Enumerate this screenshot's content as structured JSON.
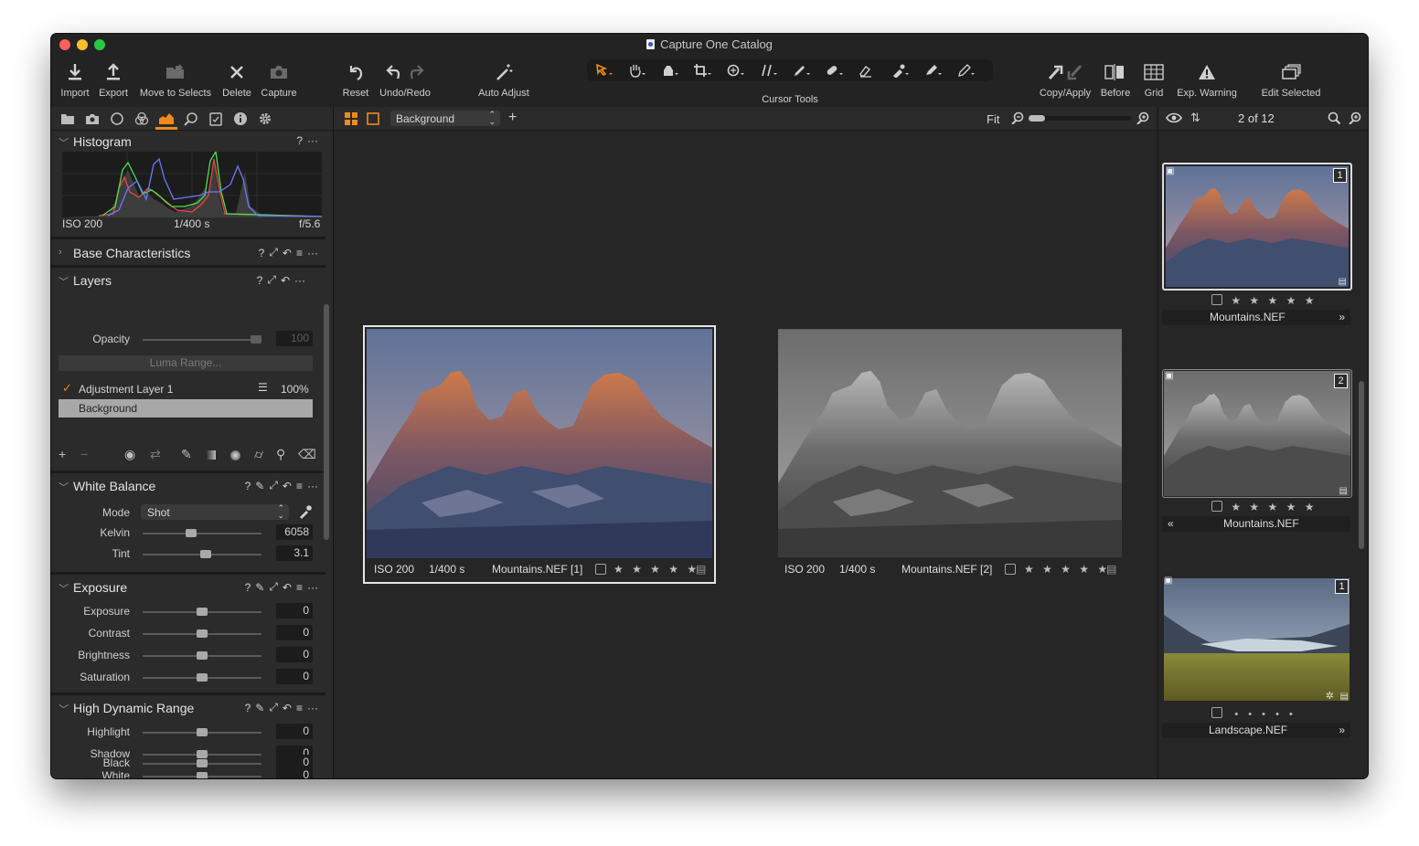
{
  "window": {
    "title": "Capture One Catalog"
  },
  "toolbar": {
    "import": "Import",
    "export": "Export",
    "move_to_selects": "Move to Selects",
    "delete": "Delete",
    "capture": "Capture",
    "reset": "Reset",
    "undo_redo": "Undo/Redo",
    "auto_adjust": "Auto Adjust",
    "cursor_tools": "Cursor Tools",
    "copy_apply": "Copy/Apply",
    "before": "Before",
    "grid": "Grid",
    "exp_warning": "Exp. Warning",
    "edit_selected": "Edit Selected"
  },
  "histogram": {
    "title": "Histogram",
    "iso": "ISO 200",
    "shutter": "1/400 s",
    "aperture": "f/5.6",
    "help": "?"
  },
  "base_characteristics": {
    "title": "Base Characteristics",
    "help": "?"
  },
  "layers": {
    "title": "Layers",
    "help": "?",
    "opacity_label": "Opacity",
    "opacity_value": "100",
    "luma_range": "Luma Range...",
    "items": [
      {
        "name": "Adjustment Layer 1",
        "opacity": "100%",
        "checked": true
      },
      {
        "name": "Background"
      }
    ]
  },
  "white_balance": {
    "title": "White Balance",
    "help": "?",
    "mode_label": "Mode",
    "mode_value": "Shot",
    "kelvin_label": "Kelvin",
    "kelvin_value": "6058",
    "tint_label": "Tint",
    "tint_value": "3.1"
  },
  "exposure": {
    "title": "Exposure",
    "help": "?",
    "rows": [
      {
        "label": "Exposure",
        "value": "0"
      },
      {
        "label": "Contrast",
        "value": "0"
      },
      {
        "label": "Brightness",
        "value": "0"
      },
      {
        "label": "Saturation",
        "value": "0"
      }
    ]
  },
  "hdr": {
    "title": "High Dynamic Range",
    "help": "?",
    "rows": [
      {
        "label": "Highlight",
        "value": "0"
      },
      {
        "label": "Shadow",
        "value": "0"
      },
      {
        "label": "White",
        "value": "0"
      },
      {
        "label": "Black",
        "value": "0"
      }
    ]
  },
  "viewer": {
    "layer_select": "Background",
    "zoom_label": "Fit",
    "images": [
      {
        "iso": "ISO 200",
        "shutter": "1/400 s",
        "name": "Mountains.NEF [1]",
        "stars": "★ ★ ★ ★ ★"
      },
      {
        "iso": "ISO 200",
        "shutter": "1/400 s",
        "name": "Mountains.NEF [2]",
        "stars": "★ ★ ★ ★ ★"
      }
    ]
  },
  "browser": {
    "counter": "2 of 12",
    "thumbs": [
      {
        "badge": "1",
        "name": "Mountains.NEF",
        "stars": "★ ★ ★ ★ ★",
        "nav": "»"
      },
      {
        "badge": "2",
        "name": "Mountains.NEF",
        "stars": "★ ★ ★ ★ ★",
        "nav": "«"
      },
      {
        "badge": "1",
        "name": "Landscape.NEF",
        "stars": "• • • • •",
        "nav": "»"
      }
    ]
  },
  "colors": {
    "accent": "#f08a1c",
    "close": "#fe5f57",
    "minimize": "#febc2e",
    "zoom": "#28c840"
  }
}
